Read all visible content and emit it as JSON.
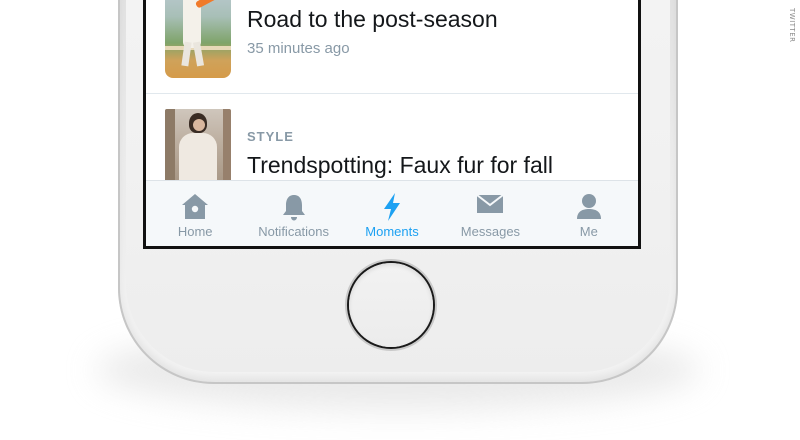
{
  "watermark": "TWITTER",
  "feed": {
    "items": [
      {
        "title": "Road to the post-season",
        "timestamp": "35 minutes ago"
      },
      {
        "category": "STYLE",
        "title": "Trendspotting: Faux fur for fall"
      }
    ]
  },
  "tab_bar": {
    "active_color": "#1da1f2",
    "inactive_color": "#8899a6",
    "tabs": [
      {
        "label": "Home",
        "icon": "home-icon"
      },
      {
        "label": "Notifications",
        "icon": "bell-icon"
      },
      {
        "label": "Moments",
        "icon": "lightning-icon",
        "active": true
      },
      {
        "label": "Messages",
        "icon": "envelope-icon"
      },
      {
        "label": "Me",
        "icon": "person-icon"
      }
    ]
  }
}
